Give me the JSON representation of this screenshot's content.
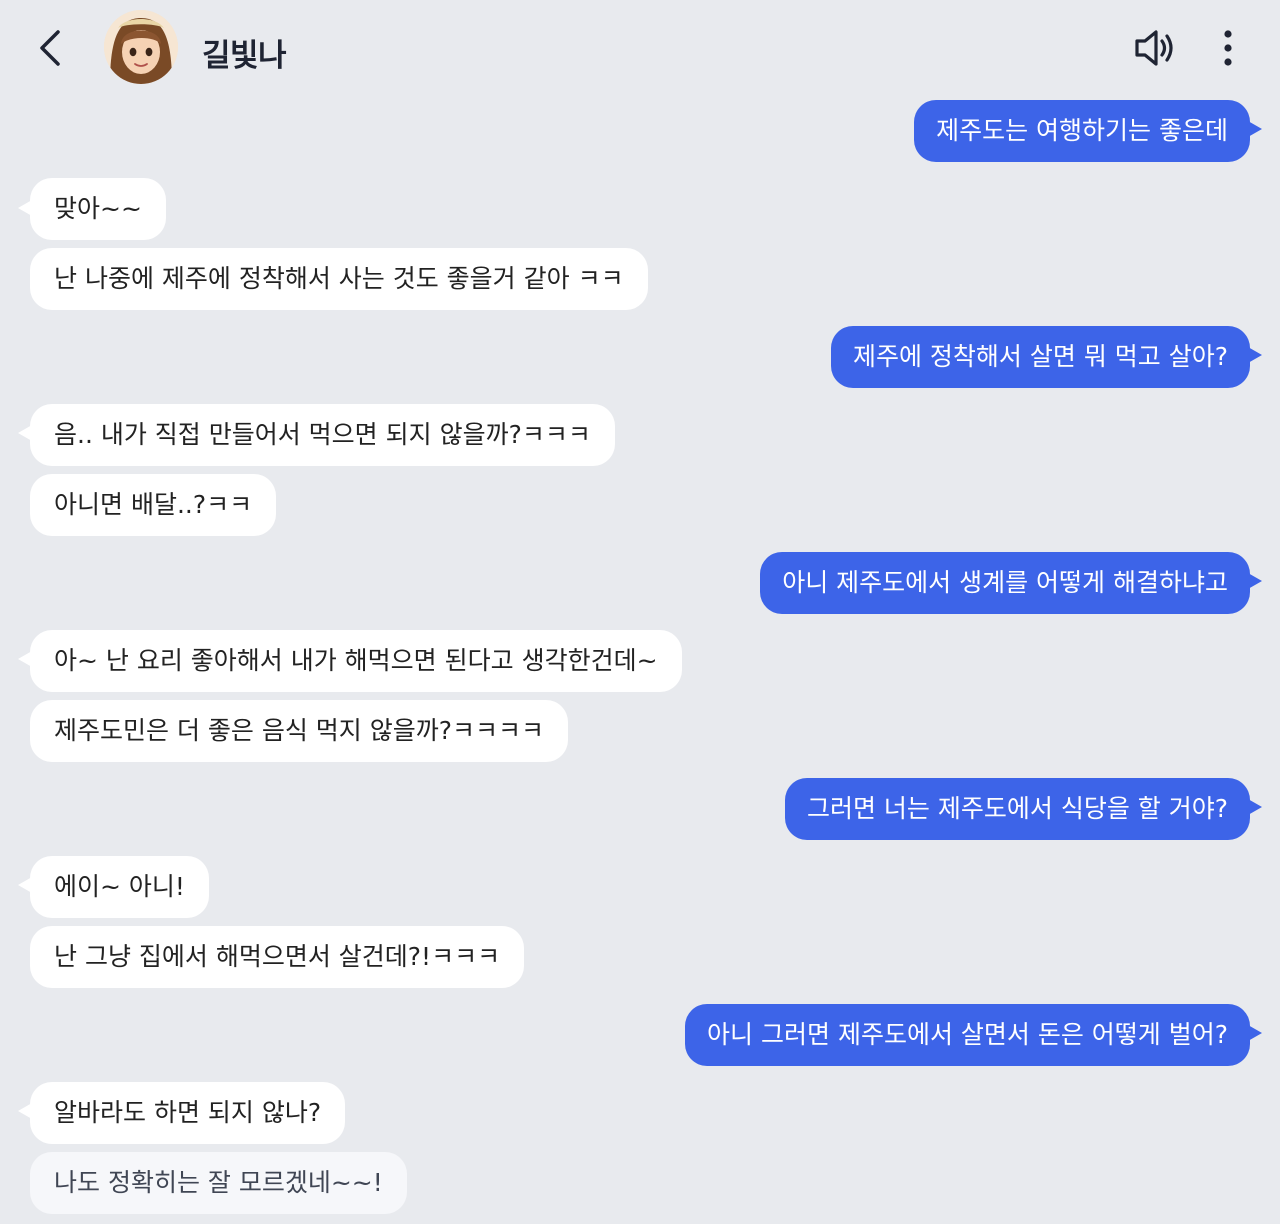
{
  "header": {
    "contact_name": "길빛나"
  },
  "messages": [
    {
      "side": "sent",
      "text": "제주도는 여행하기는 좋은데"
    },
    {
      "side": "recv",
      "text": "맞아~~"
    },
    {
      "side": "recv",
      "text": "난 나중에 제주에 정착해서 사는 것도 좋을거 같아 ㅋㅋ"
    },
    {
      "side": "sent",
      "text": "제주에 정착해서 살면 뭐 먹고 살아?"
    },
    {
      "side": "recv",
      "text": "음.. 내가 직접 만들어서 먹으면 되지 않을까?ㅋㅋㅋ"
    },
    {
      "side": "recv",
      "text": "아니면 배달..?ㅋㅋ"
    },
    {
      "side": "sent",
      "text": "아니 제주도에서 생계를 어떻게 해결하냐고"
    },
    {
      "side": "recv",
      "text": "아~ 난 요리 좋아해서 내가 해먹으면 된다고 생각한건데~"
    },
    {
      "side": "recv",
      "text": "제주도민은 더 좋은 음식 먹지 않을까?ㅋㅋㅋㅋ"
    },
    {
      "side": "sent",
      "text": "그러면 너는 제주도에서 식당을 할 거야?"
    },
    {
      "side": "recv",
      "text": "에이~ 아니!"
    },
    {
      "side": "recv",
      "text": "난 그냥 집에서 해먹으면서 살건데?!ㅋㅋㅋ"
    },
    {
      "side": "sent",
      "text": "아니 그러면 제주도에서 살면서 돈은 어떻게 벌어?"
    },
    {
      "side": "recv",
      "text": "알바라도 하면 되지 않나?"
    },
    {
      "side": "recv",
      "text": "나도 정확히는 잘 모르겠네~~!"
    }
  ],
  "colors": {
    "background": "#e8eaee",
    "sent_bubble": "#3d64e8",
    "recv_bubble": "#ffffff"
  },
  "icons": {
    "back": "back-arrow-icon",
    "speaker": "speaker-icon",
    "more": "more-vertical-icon"
  }
}
